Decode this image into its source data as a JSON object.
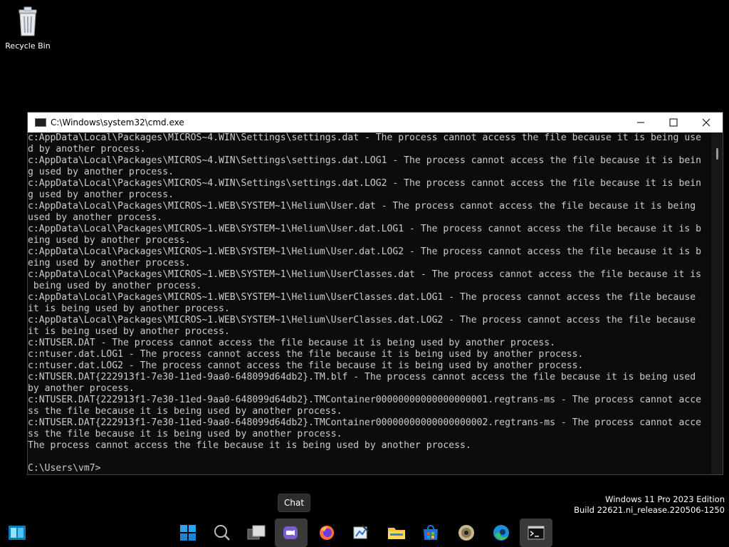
{
  "desktop": {
    "icons": [
      {
        "label": "Recycle Bin",
        "icon": "recycle-bin-icon"
      }
    ]
  },
  "window": {
    "title": "C:\\Windows\\system32\\cmd.exe",
    "controls": [
      "minimize-icon",
      "maximize-icon",
      "close-icon"
    ],
    "console_lines": [
      "c:AppData\\Local\\Packages\\MICROS~4.WIN\\Settings\\settings.dat - The process cannot access the file because it is being use",
      "d by another process.",
      "c:AppData\\Local\\Packages\\MICROS~4.WIN\\Settings\\settings.dat.LOG1 - The process cannot access the file because it is bein",
      "g used by another process.",
      "c:AppData\\Local\\Packages\\MICROS~4.WIN\\Settings\\settings.dat.LOG2 - The process cannot access the file because it is bein",
      "g used by another process.",
      "c:AppData\\Local\\Packages\\MICROS~1.WEB\\SYSTEM~1\\Helium\\User.dat - The process cannot access the file because it is being",
      "used by another process.",
      "c:AppData\\Local\\Packages\\MICROS~1.WEB\\SYSTEM~1\\Helium\\User.dat.LOG1 - The process cannot access the file because it is b",
      "eing used by another process.",
      "c:AppData\\Local\\Packages\\MICROS~1.WEB\\SYSTEM~1\\Helium\\User.dat.LOG2 - The process cannot access the file because it is b",
      "eing used by another process.",
      "c:AppData\\Local\\Packages\\MICROS~1.WEB\\SYSTEM~1\\Helium\\UserClasses.dat - The process cannot access the file because it is",
      " being used by another process.",
      "c:AppData\\Local\\Packages\\MICROS~1.WEB\\SYSTEM~1\\Helium\\UserClasses.dat.LOG1 - The process cannot access the file because",
      "it is being used by another process.",
      "c:AppData\\Local\\Packages\\MICROS~1.WEB\\SYSTEM~1\\Helium\\UserClasses.dat.LOG2 - The process cannot access the file because",
      "it is being used by another process.",
      "c:NTUSER.DAT - The process cannot access the file because it is being used by another process.",
      "c:ntuser.dat.LOG1 - The process cannot access the file because it is being used by another process.",
      "c:ntuser.dat.LOG2 - The process cannot access the file because it is being used by another process.",
      "c:NTUSER.DAT{222913f1-7e30-11ed-9aa0-648099d64db2}.TM.blf - The process cannot access the file because it is being used",
      "by another process.",
      "c:NTUSER.DAT{222913f1-7e30-11ed-9aa0-648099d64db2}.TMContainer00000000000000000001.regtrans-ms - The process cannot acce",
      "ss the file because it is being used by another process.",
      "c:NTUSER.DAT{222913f1-7e30-11ed-9aa0-648099d64db2}.TMContainer00000000000000000002.regtrans-ms - The process cannot acce",
      "ss the file because it is being used by another process.",
      "The process cannot access the file because it is being used by another process.",
      "",
      "C:\\Users\\vm7>"
    ]
  },
  "tooltip": {
    "text": "Chat"
  },
  "watermark": {
    "line1": "Windows 11 Pro 2023 Edition",
    "line2": "Build 22621.ni_release.220506-1250"
  },
  "taskbar": {
    "items": [
      {
        "name": "widgets-icon",
        "active": false
      },
      {
        "name": "start-icon",
        "active": false
      },
      {
        "name": "search-icon",
        "active": false
      },
      {
        "name": "task-view-icon",
        "active": false
      },
      {
        "name": "chat-icon",
        "active": true
      },
      {
        "name": "firefox-icon",
        "active": false
      },
      {
        "name": "paint-icon",
        "active": false
      },
      {
        "name": "file-explorer-icon",
        "active": false
      },
      {
        "name": "store-icon",
        "active": false
      },
      {
        "name": "disc-icon",
        "active": false
      },
      {
        "name": "edge-icon",
        "active": false
      },
      {
        "name": "terminal-icon",
        "active": true
      }
    ]
  },
  "colors": {
    "console_bg": "#0c0c0c",
    "console_text": "#cccccc",
    "desktop_bg": "#000000",
    "accent": "#0078d4"
  }
}
